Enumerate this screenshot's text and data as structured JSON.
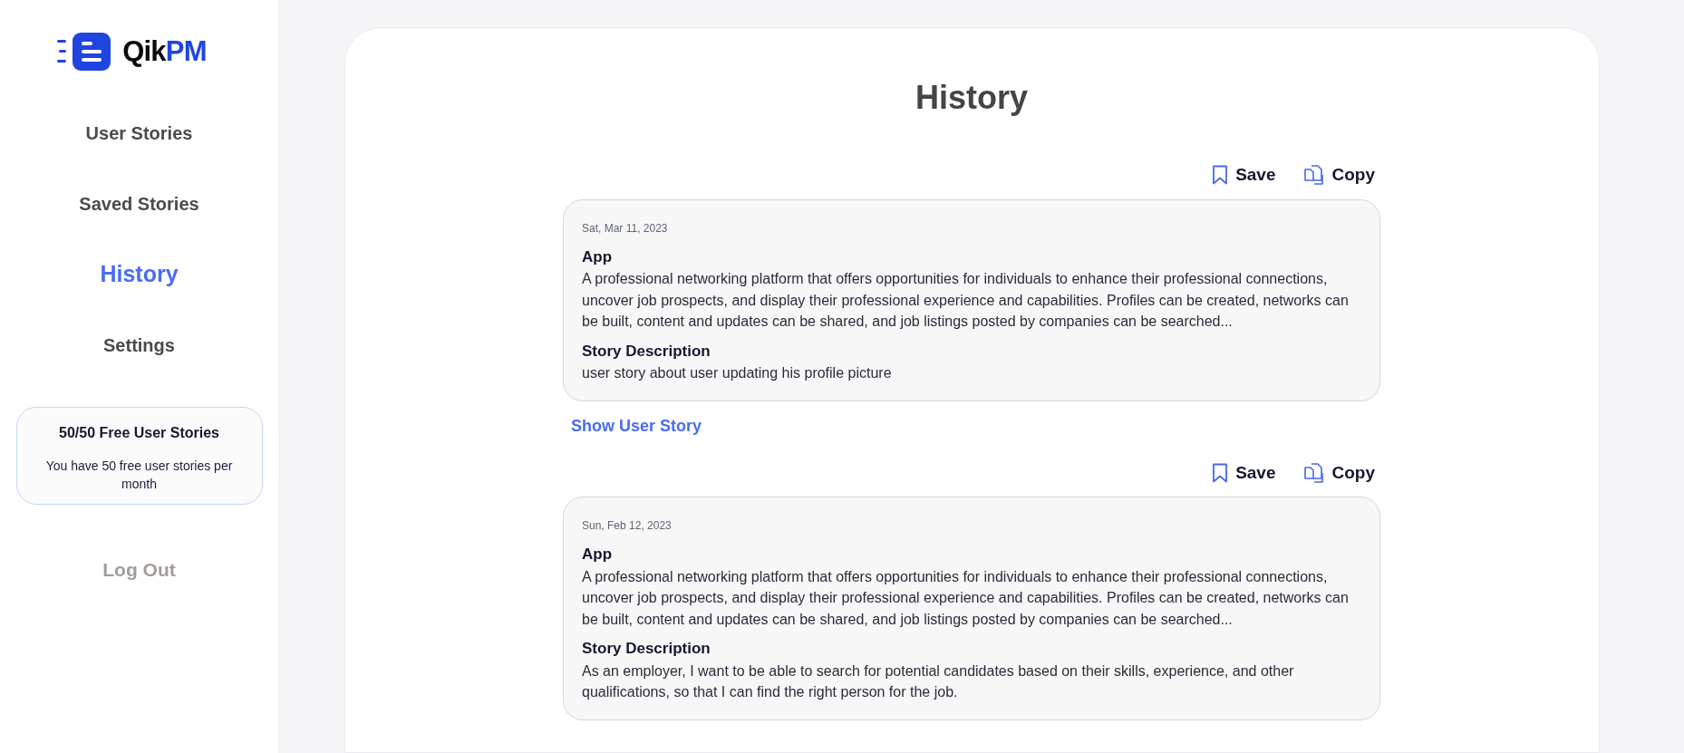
{
  "logo": {
    "text_dark": "Qik",
    "text_accent": "PM"
  },
  "nav": [
    {
      "label": "User Stories",
      "selected": false
    },
    {
      "label": "Saved Stories",
      "selected": false
    },
    {
      "label": "History",
      "selected": true
    },
    {
      "label": "Settings",
      "selected": false
    }
  ],
  "quota_card": {
    "title": "50/50 Free User Stories",
    "text": "You have 50 free user stories per month"
  },
  "logout": "Log Out",
  "page_title": "History",
  "entries": [
    {
      "actions": [
        {
          "kind": "save",
          "label": "Save"
        },
        {
          "kind": "copy",
          "label": "Copy"
        }
      ],
      "date": "Sat, Mar 11, 2023",
      "app_label": "App",
      "app_text": "A professional networking platform that offers opportunities for individuals to enhance their professional connections, uncover job prospects, and display their professional experience and capabilities. Profiles can be created, networks can be built, content and updates can be shared, and job listings posted by companies can be searched...",
      "story_label": "Story Description",
      "story_text": "user story about user updating his profile picture",
      "link": "Show User Story"
    },
    {
      "actions": [
        {
          "kind": "save",
          "label": "Save"
        },
        {
          "kind": "copy",
          "label": "Copy"
        }
      ],
      "date": "Sun, Feb 12, 2023",
      "app_label": "App",
      "app_text": "A professional networking platform that offers opportunities for individuals to enhance their professional connections, uncover job prospects, and display their professional experience and capabilities. Profiles can be created, networks can be built, content and updates can be shared, and job listings posted by companies can be searched...",
      "story_label": "Story Description",
      "story_text": "As an employer, I want to be able to search for potential candidates based on their skills, experience, and other qualifications, so that I can find the right person for the job."
    }
  ]
}
